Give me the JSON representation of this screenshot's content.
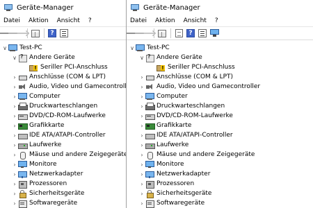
{
  "title": "Geräte-Manager",
  "menu": [
    "Datei",
    "Aktion",
    "Ansicht",
    "?"
  ],
  "tree": {
    "root": "Test-PC",
    "categories": [
      {
        "label": "Andere Geräte",
        "icon": "unknown-device-icon",
        "expanded": true
      },
      {
        "label": "Seriller PCI-Anschluss",
        "icon": "pci-warning-icon",
        "child": true
      },
      {
        "label": "Anschlüsse (COM & LPT)",
        "icon": "port-icon"
      },
      {
        "label": "Audio, Video und Gamecontroller",
        "icon": "audio-icon"
      },
      {
        "label": "Computer",
        "icon": "computer-icon"
      },
      {
        "label": "Druckwarteschlangen",
        "icon": "print-queue-icon"
      },
      {
        "label": "DVD/CD-ROM-Laufwerke",
        "icon": "dvd-drive-icon"
      },
      {
        "label": "Grafikkarte",
        "icon": "graphics-card-icon"
      },
      {
        "label": "IDE ATA/ATAPI-Controller",
        "icon": "ide-controller-icon"
      },
      {
        "label": "Laufwerke",
        "icon": "disk-drive-icon"
      },
      {
        "label": "Mäuse und andere Zeigegeräte",
        "icon": "mouse-icon"
      },
      {
        "label": "Monitore",
        "icon": "monitor-icon"
      },
      {
        "label": "Netzwerkadapter",
        "icon": "network-adapter-icon"
      },
      {
        "label": "Prozessoren",
        "icon": "processor-icon"
      },
      {
        "label": "Sicherheitsgeräte",
        "icon": "security-device-icon"
      },
      {
        "label": "Softwaregeräte",
        "icon": "software-device-icon"
      }
    ]
  }
}
